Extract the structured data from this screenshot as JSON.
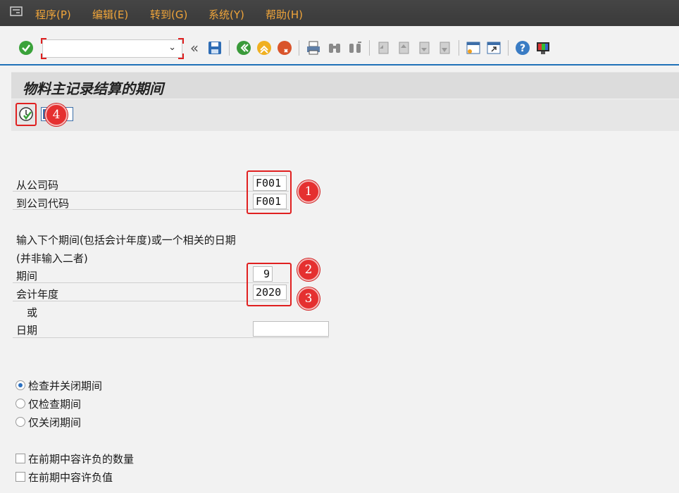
{
  "menu": {
    "items": [
      "程序(P)",
      "编辑(E)",
      "转到(G)",
      "系统(Y)",
      "帮助(H)"
    ]
  },
  "toolbar": {
    "command_value": "",
    "icons": [
      "enter-check-icon",
      "collapse-icon",
      "save-icon",
      "back-icon",
      "exit-icon",
      "cancel-icon",
      "print-icon",
      "find-icon",
      "find-next-icon",
      "first-page-icon",
      "prev-page-icon",
      "next-page-icon",
      "last-page-icon",
      "new-session-icon",
      "shortcut-icon",
      "help-icon",
      "customize-layout-icon"
    ]
  },
  "page": {
    "title": "物料主记录结算的期间",
    "execute_icon": "execute-icon",
    "variant_icon": "variant-icon"
  },
  "form": {
    "from_company_label": "从公司码",
    "from_company_value": "F001",
    "to_company_label": "到公司代码",
    "to_company_value": "F001",
    "hint_line1": "输入下个期间(包括会计年度)或一个相关的日期",
    "hint_line2": "(并非输入二者)",
    "period_label": "期间",
    "period_value": "9",
    "fiscal_year_label": "会计年度",
    "fiscal_year_value": "2020",
    "or_label": "或",
    "date_label": "日期",
    "date_value": ""
  },
  "options": {
    "radios": [
      {
        "label": "检查并关闭期间",
        "selected": true
      },
      {
        "label": "仅检查期间",
        "selected": false
      },
      {
        "label": "仅关闭期间",
        "selected": false
      }
    ],
    "checkboxes": [
      {
        "label": "在前期中容许负的数量",
        "checked": false
      },
      {
        "label": "在前期中容许负值",
        "checked": false
      }
    ]
  },
  "annotations": [
    "1",
    "2",
    "3",
    "4"
  ],
  "colors": {
    "menu_text": "#f0a53a",
    "highlight_red": "#e02020",
    "accent_blue": "#1f72b8"
  }
}
